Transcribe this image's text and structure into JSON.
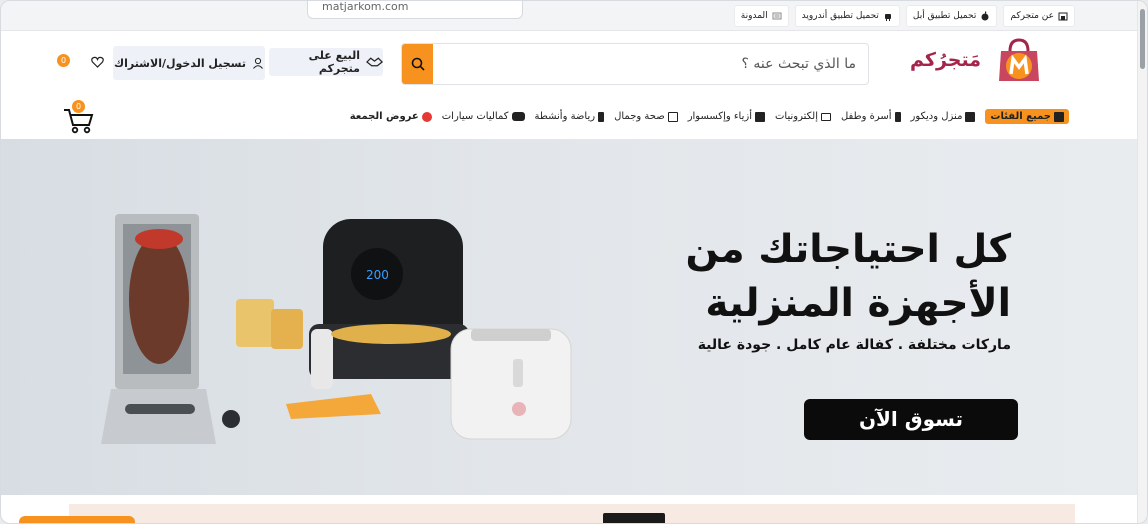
{
  "browser": {
    "url_hint": "matjarkom.com"
  },
  "top_links": [
    {
      "label": "عن متجركم",
      "icon": "store-icon"
    },
    {
      "label": "تحميل تطبيق أبل",
      "icon": "apple-icon"
    },
    {
      "label": "تحميل تطبيق أندرويد",
      "icon": "android-icon"
    },
    {
      "label": "المدونة",
      "icon": "blog-icon"
    }
  ],
  "header": {
    "brand": "مَتجرُكم",
    "search_placeholder": "ما الذي تبحث عنه ؟",
    "sell_label": "البيع على متجركم",
    "login_label": "تسجيل الدخول/الاشتراك",
    "wishlist_count": "0",
    "cart_count": "0"
  },
  "nav": {
    "items": [
      {
        "label": "جميع الفئات",
        "icon": "grid-icon"
      },
      {
        "label": "منزل وديكور",
        "icon": "lamp-icon"
      },
      {
        "label": "أسرة وطفل",
        "icon": "baby-icon"
      },
      {
        "label": "إلكترونيات",
        "icon": "laptop-icon"
      },
      {
        "label": "أزياء وإكسسوار",
        "icon": "bag-icon"
      },
      {
        "label": "صحة وجمال",
        "icon": "beauty-icon"
      },
      {
        "label": "رياضة وأنشطة",
        "icon": "sport-icon"
      },
      {
        "label": "كماليات سيارات",
        "icon": "car-icon"
      },
      {
        "label": "عروض الجمعة",
        "icon": "deal-icon"
      }
    ]
  },
  "hero": {
    "title_line1": "كل احتياجاتك من",
    "title_line2": "الأجهزة المنزلية",
    "subtitle": "ماركات مختلفة . كفالة عام كامل . جودة عالية",
    "cta_label": "تسوق الآن"
  },
  "colors": {
    "accent": "#f7921e",
    "brand": "#a5244a",
    "cta": "#0b0b0b"
  }
}
